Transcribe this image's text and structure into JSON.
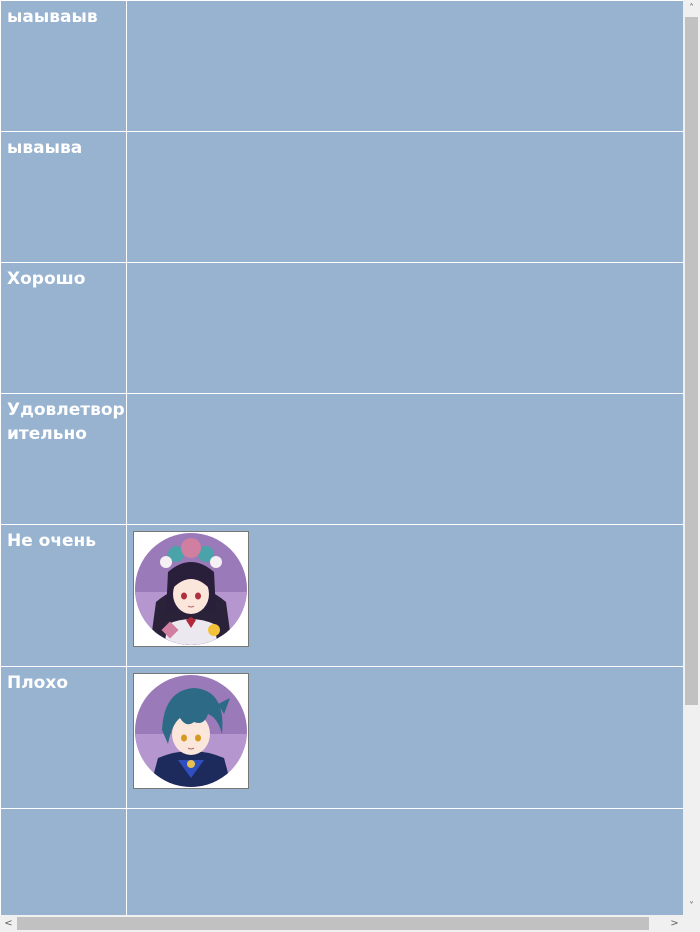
{
  "tiers": [
    {
      "label": "ыаываыв",
      "characters": []
    },
    {
      "label": "ываыва",
      "characters": []
    },
    {
      "label": "Хорошо",
      "characters": []
    },
    {
      "label": "Удовлетворительно",
      "characters": []
    },
    {
      "label": "Не очень",
      "characters": [
        "yun-jin-portrait"
      ]
    },
    {
      "label": "Плохо",
      "characters": [
        "xingqiu-portrait"
      ]
    },
    {
      "label": "",
      "characters": []
    }
  ],
  "scrollbars": {
    "up_arrow": "˄",
    "down_arrow": "˅",
    "left_arrow": "<",
    "right_arrow": ">"
  },
  "colors": {
    "row_background": "#98b3d0",
    "label_text": "#ffffff",
    "grid_lines": "#ffffff"
  }
}
